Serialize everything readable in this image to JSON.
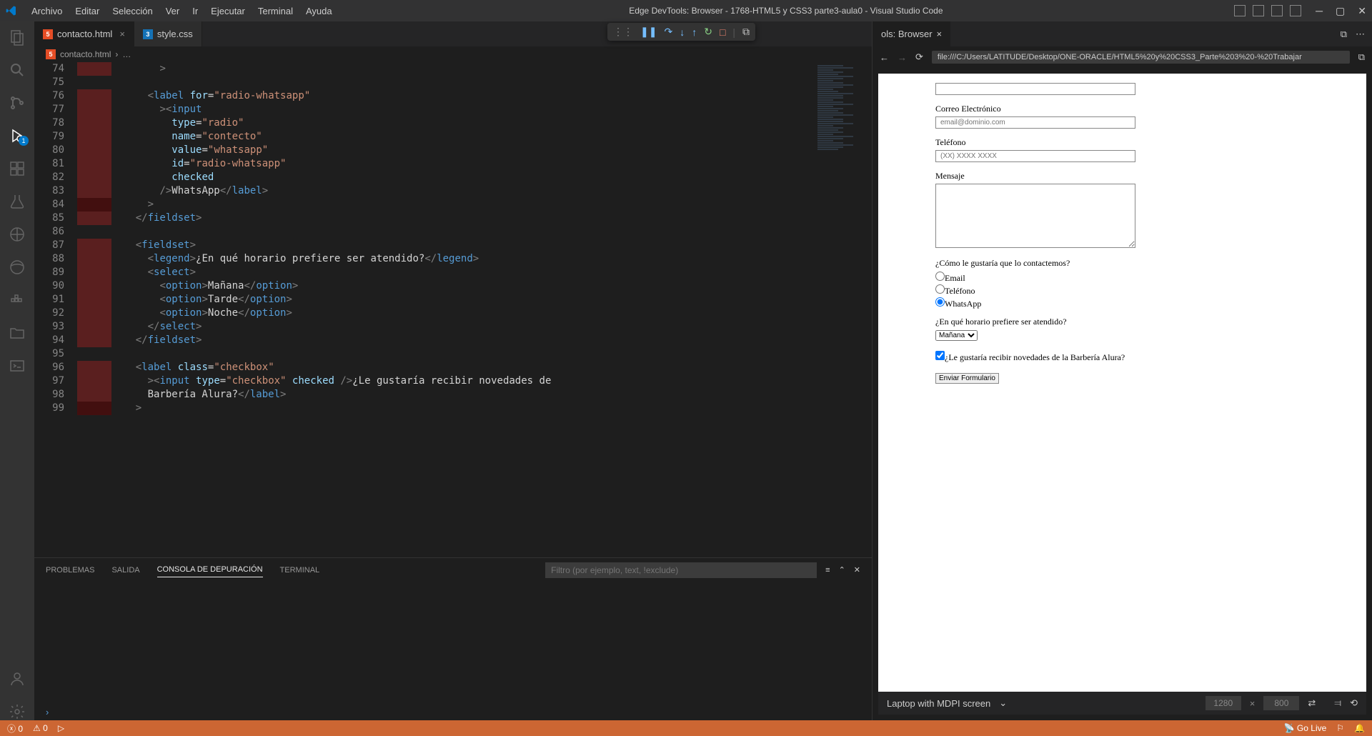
{
  "menu": {
    "file": "Archivo",
    "edit": "Editar",
    "selection": "Selección",
    "view": "Ver",
    "go": "Ir",
    "run": "Ejecutar",
    "terminal": "Terminal",
    "help": "Ayuda"
  },
  "title": "Edge DevTools: Browser - 1768-HTML5 y CSS3 parte3-aula0 - Visual Studio Code",
  "tabs": {
    "t1": "contacto.html",
    "t2": "style.css",
    "t3": "ols: Browser"
  },
  "breadcrumb": {
    "file": "contacto.html",
    "sep": "›",
    "more": "…"
  },
  "lines": [
    "74",
    "75",
    "76",
    "77",
    "78",
    "79",
    "80",
    "81",
    "82",
    "83",
    "84",
    "85",
    "86",
    "87",
    "88",
    "89",
    "90",
    "91",
    "92",
    "93",
    "94",
    "95",
    "96",
    "97",
    "98",
    "99"
  ],
  "code": {
    "l76_for": "\"radio-whatsapp\"",
    "l78_type": "\"radio\"",
    "l79_name": "\"contecto\"",
    "l80_value": "\"whatsapp\"",
    "l81_id": "\"radio-whatsapp\"",
    "l82_checked": "checked",
    "l83_text": "WhatsApp",
    "l88_text": "¿En qué horario prefiere ser atendido?",
    "l90_opt": "Mañana",
    "l91_opt": "Tarde",
    "l92_opt": "Noche",
    "l96_class": "\"checkbox\"",
    "l97_type": "\"checkbox\"",
    "l97_checked": "checked",
    "l97_text": "¿Le gustaría recibir novedades de",
    "l98_text": "Barbería Alura?"
  },
  "panel": {
    "problems": "PROBLEMAS",
    "output": "SALIDA",
    "debug": "CONSOLA DE DEPURACIÓN",
    "terminal": "TERMINAL",
    "filter": "Filtro (por ejemplo, text, !exclude)"
  },
  "browser": {
    "url": "file:///C:/Users/LATITUDE/Desktop/ONE-ORACLE/HTML5%20y%20CSS3_Parte%203%20-%20Trabajar",
    "email_label": "Correo Electrónico",
    "email_ph": "email@dominio.com",
    "tel_label": "Teléfono",
    "tel_ph": "(XX) XXXX XXXX",
    "msg_label": "Mensaje",
    "contact_q": "¿Cómo le gustaría que lo contactemos?",
    "r1": "Email",
    "r2": "Teléfono",
    "r3": "WhatsApp",
    "schedule_q": "¿En qué horario prefiere ser atendido?",
    "sel": "Mañana",
    "chk": "¿Le gustaría recibir novedades de la Barbería Alura?",
    "submit": "Enviar Formulario"
  },
  "device": {
    "name": "Laptop with MDPI screen",
    "w": "1280",
    "h": "800"
  },
  "status": {
    "errors": "0",
    "warnings": "0",
    "golive": "Go Live"
  },
  "debug_badge": "1"
}
